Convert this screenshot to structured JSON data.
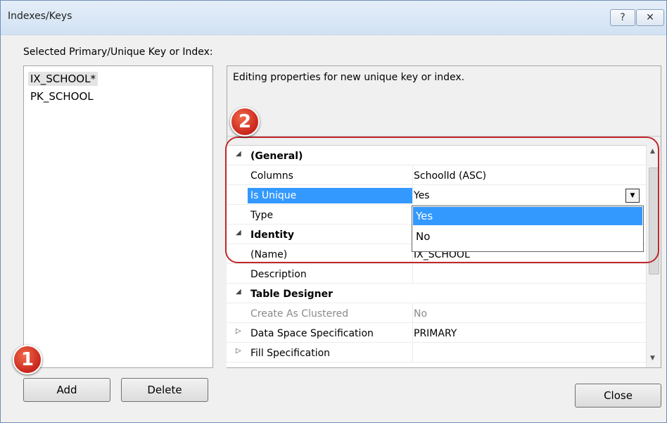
{
  "window": {
    "title": "Indexes/Keys",
    "help_label": "?",
    "close_label": "✕"
  },
  "left": {
    "label": "Selected Primary/Unique Key or Index:",
    "items": [
      "IX_SCHOOL*",
      "PK_SCHOOL"
    ],
    "add_label": "Add",
    "delete_label": "Delete"
  },
  "edit_panel": {
    "text": "Editing properties for new unique key or index."
  },
  "grid": {
    "general": {
      "label": "(General)",
      "columns_name": "Columns",
      "columns_value": "SchoolId (ASC)",
      "unique_name": "Is Unique",
      "unique_value": "Yes",
      "type_name": "Type",
      "type_value": ""
    },
    "identity": {
      "label": "Identity",
      "name_name": "(Name)",
      "name_value": "IX_SCHOOL",
      "description_name": "Description",
      "description_value": ""
    },
    "table_designer": {
      "label": "Table Designer",
      "clustered_name": "Create As Clustered",
      "clustered_value": "No",
      "dataspace_name": "Data Space Specification",
      "dataspace_value": "PRIMARY",
      "fill_name": "Fill Specification",
      "fill_value": ""
    }
  },
  "dropdown": {
    "options": [
      "Yes",
      "No"
    ],
    "selected": "Yes"
  },
  "footer": {
    "close_label": "Close"
  },
  "badges": {
    "one": "1",
    "two": "2"
  },
  "colors": {
    "selection": "#3399ff",
    "callout": "#c0282a"
  },
  "icons": {
    "collapse": "collapse-triangle-icon",
    "expand": "expand-triangle-icon",
    "dropdown": "chevron-down-icon"
  }
}
